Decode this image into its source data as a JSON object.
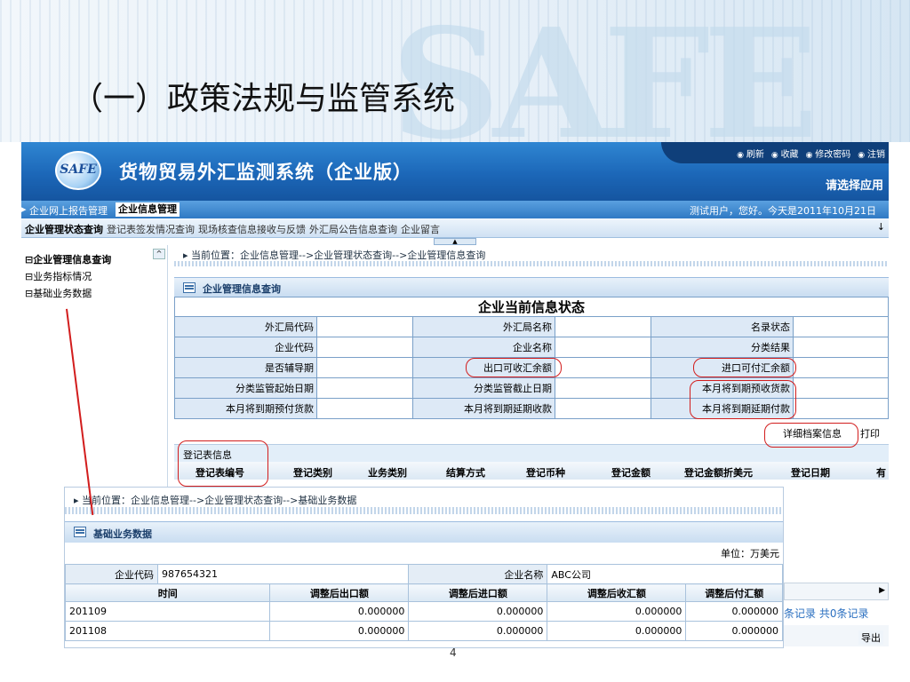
{
  "slide": {
    "title": "（一）政策法规与监管系统",
    "watermark": "SAFE",
    "page": "4"
  },
  "app": {
    "logo_text": "SAFE",
    "title": "货物贸易外汇监测系统（企业版）",
    "top_links": [
      "刷新",
      "收藏",
      "修改密码",
      "注销"
    ],
    "select_app": "请选择应用",
    "nav1": [
      "企业网上报告管理",
      "企业信息管理"
    ],
    "greeting": "测试用户，您好。今天是2011年10月21日",
    "nav2": [
      "企业管理状态查询",
      "登记表签发情况查询",
      "现场核查信息接收与反馈",
      "外汇局公告信息查询",
      "企业留言"
    ],
    "sidebar": [
      "⊟企业管理信息查询",
      "⊟业务指标情况",
      "⊟基础业务数据"
    ],
    "main": {
      "breadcrumb": "▸  当前位置：企业信息管理-->企业管理状态查询-->企业管理信息查询",
      "panel_title": "企业管理信息查询",
      "table_caption": "企业当前信息状态",
      "rows": [
        [
          "外汇局代码",
          "外汇局名称",
          "名录状态"
        ],
        [
          "企业代码",
          "企业名称",
          "分类结果"
        ],
        [
          "是否辅导期",
          "出口可收汇余额",
          "进口可付汇余额"
        ],
        [
          "分类监管起始日期",
          "分类监管截止日期",
          "本月将到期预收货款"
        ],
        [
          "本月将到期预付货款",
          "本月将到期延期收款",
          "本月将到期延期付款"
        ]
      ],
      "btn_detail": "详细档案信息",
      "btn_print": "打印",
      "reg_title": "登记表信息",
      "reg_cols": [
        "登记表编号",
        "登记类别",
        "业务类别",
        "结算方式",
        "登记币种",
        "登记金额",
        "登记金额折美元",
        "登记日期",
        "有"
      ],
      "records": "条记录 共0条记录",
      "btn_export": "导出"
    }
  },
  "overlay": {
    "breadcrumb": "▸  当前位置：企业信息管理-->企业管理状态查询-->基础业务数据",
    "panel_title": "基础业务数据",
    "unit": "单位：万美元",
    "code_label": "企业代码",
    "code_value": "987654321",
    "name_label": "企业名称",
    "name_value": "ABC公司",
    "cols": [
      "时间",
      "调整后出口额",
      "调整后进口额",
      "调整后收汇额",
      "调整后付汇额"
    ],
    "rows": [
      [
        "201109",
        "0.000000",
        "0.000000",
        "0.000000",
        "0.000000"
      ],
      [
        "201108",
        "0.000000",
        "0.000000",
        "0.000000",
        "0.000000"
      ]
    ]
  }
}
